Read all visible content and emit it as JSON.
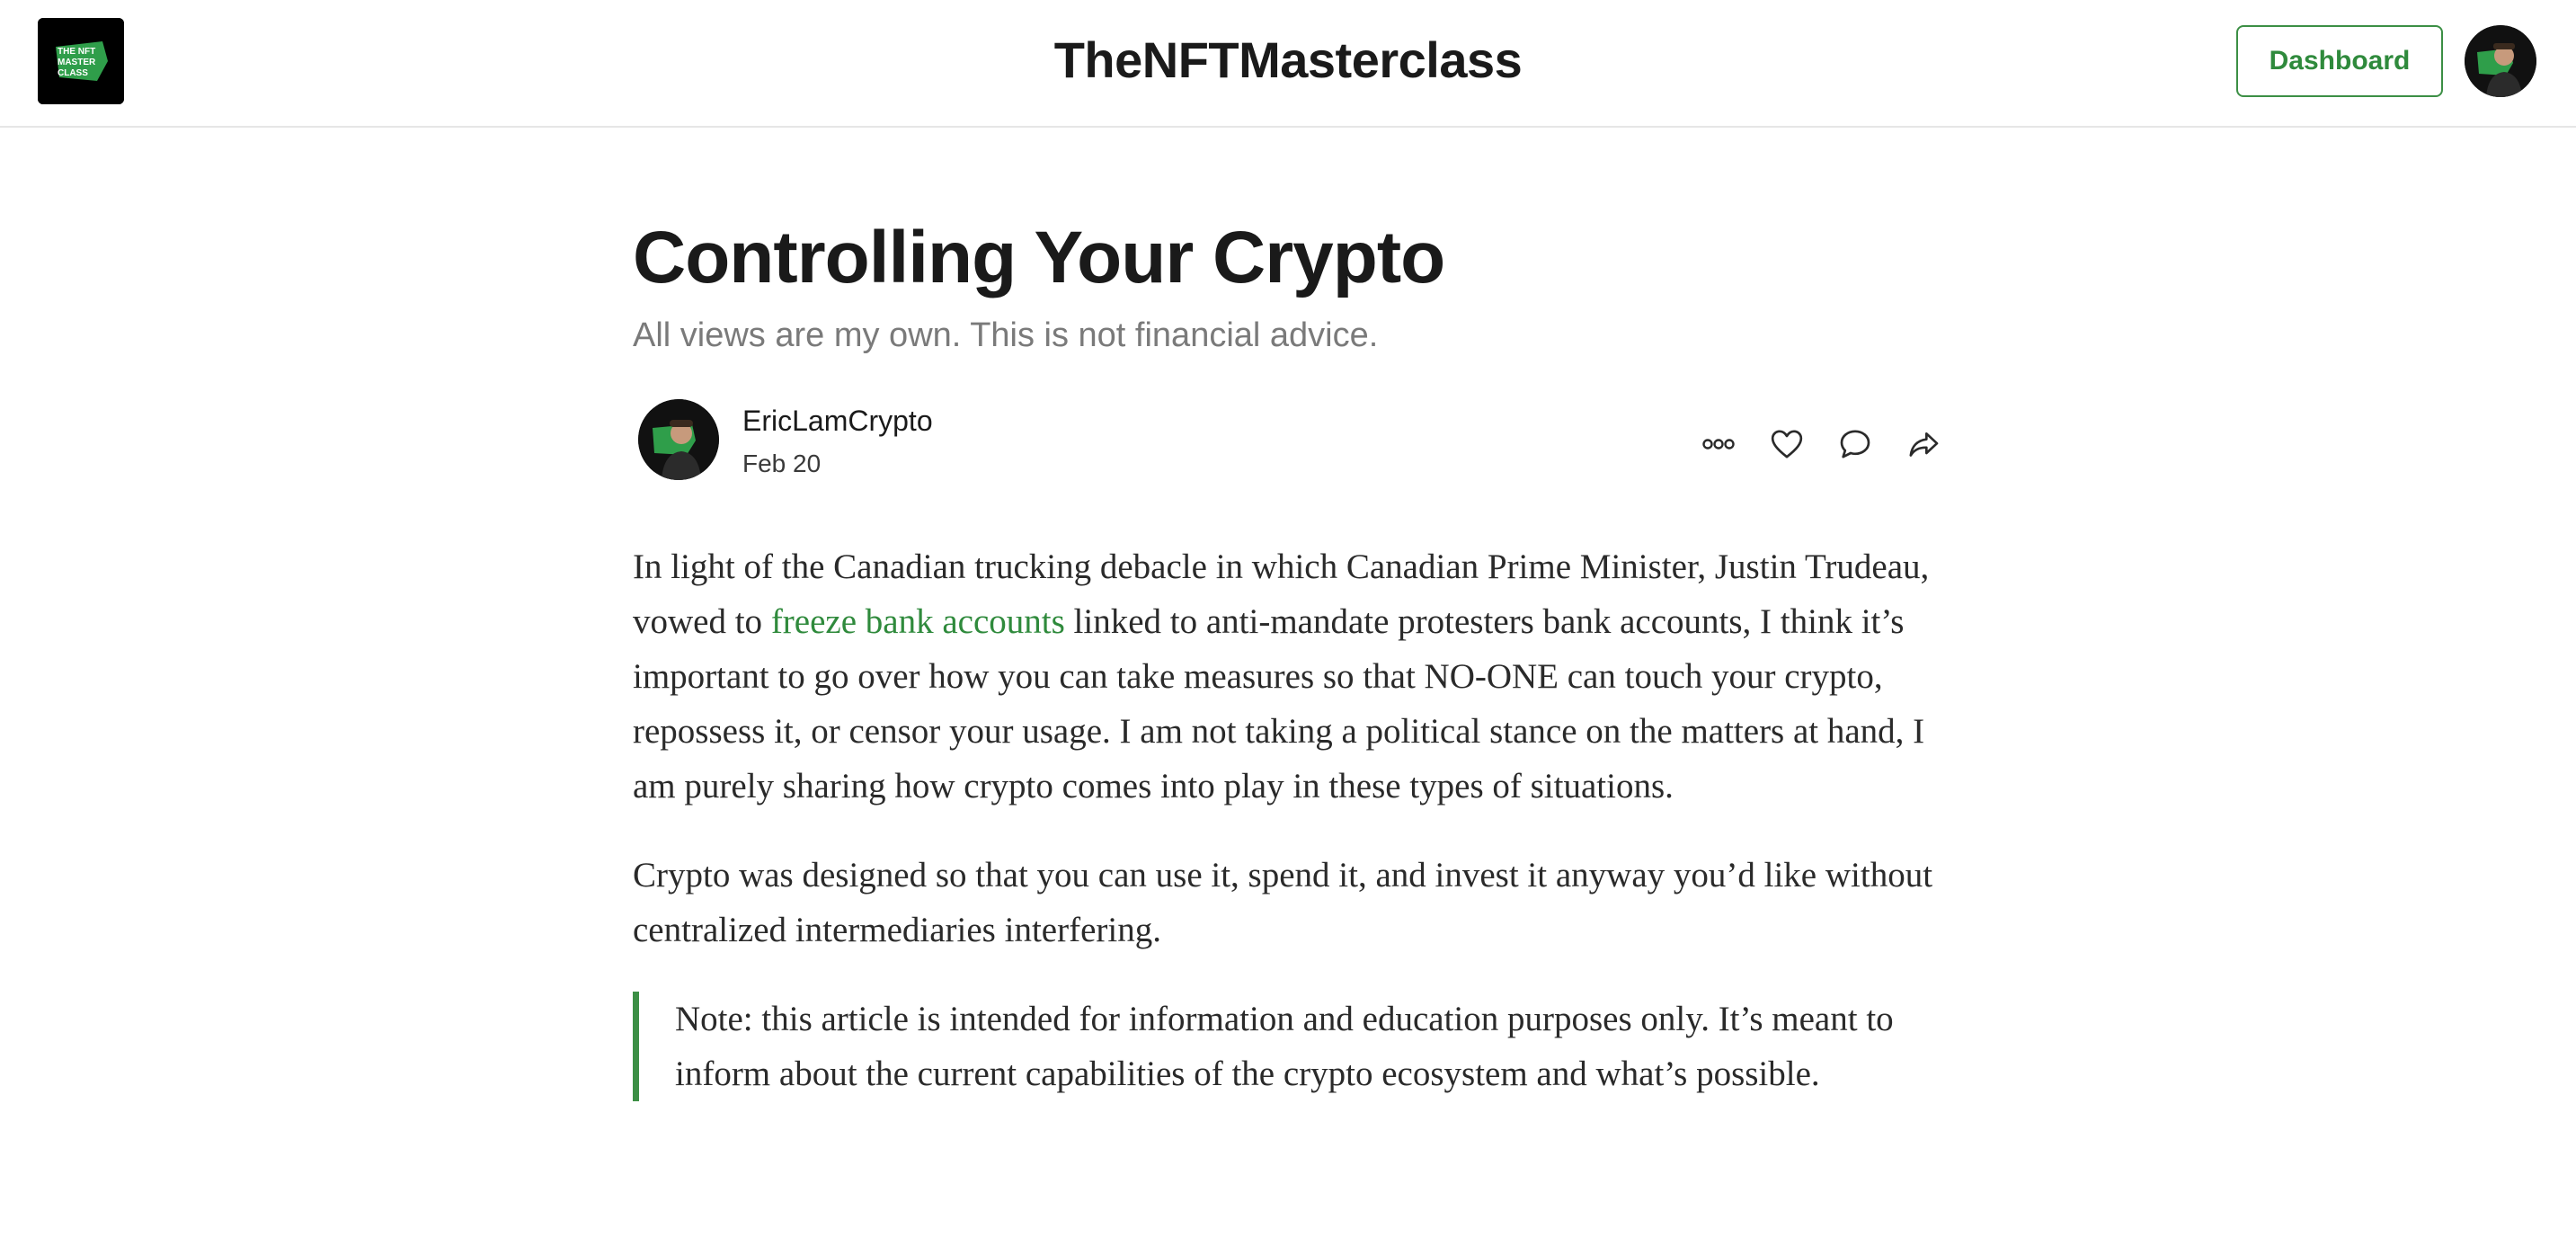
{
  "header": {
    "publication_title": "TheNFTMasterclass",
    "dashboard_label": "Dashboard",
    "logo_icon": "nft-masterclass-logo",
    "avatar_icon": "user-avatar",
    "logo_text_lines": [
      "THE NFT",
      "MASTER",
      "CLASS"
    ]
  },
  "post": {
    "title": "Controlling Your Crypto",
    "subtitle": "All views are my own. This is not financial advice.",
    "author": "EricLamCrypto",
    "date": "Feb 20",
    "actions": [
      {
        "name": "more-options",
        "icon": "ellipsis-icon"
      },
      {
        "name": "like",
        "icon": "heart-icon"
      },
      {
        "name": "comment",
        "icon": "speech-bubble-icon"
      },
      {
        "name": "share",
        "icon": "share-arrow-icon"
      }
    ],
    "paragraph1": {
      "before_link": "In light of the Canadian trucking debacle in which Canadian Prime Minister, Justin Trudeau, vowed to ",
      "link_text": "freeze bank accounts",
      "after_link": " linked to anti-mandate protesters bank accounts, I think it’s important to go over how you can take measures so that NO-ONE can touch your crypto, repossess it, or censor your usage. I am not taking a political stance on the matters at hand, I am purely sharing how crypto comes into play in these types of situations."
    },
    "paragraph2": "Crypto was designed so that you can use it, spend it, and invest it anyway you’d like without centralized intermediaries interfering.",
    "note": "Note: this article is intended for information and education purposes only. It’s meant to inform about the current capabilities of the crypto ecosystem and what’s possible."
  },
  "colors": {
    "accent": "#3c8f45",
    "link": "#2f8a3c",
    "text": "#2a2a2a",
    "muted": "#7a7a7a"
  }
}
